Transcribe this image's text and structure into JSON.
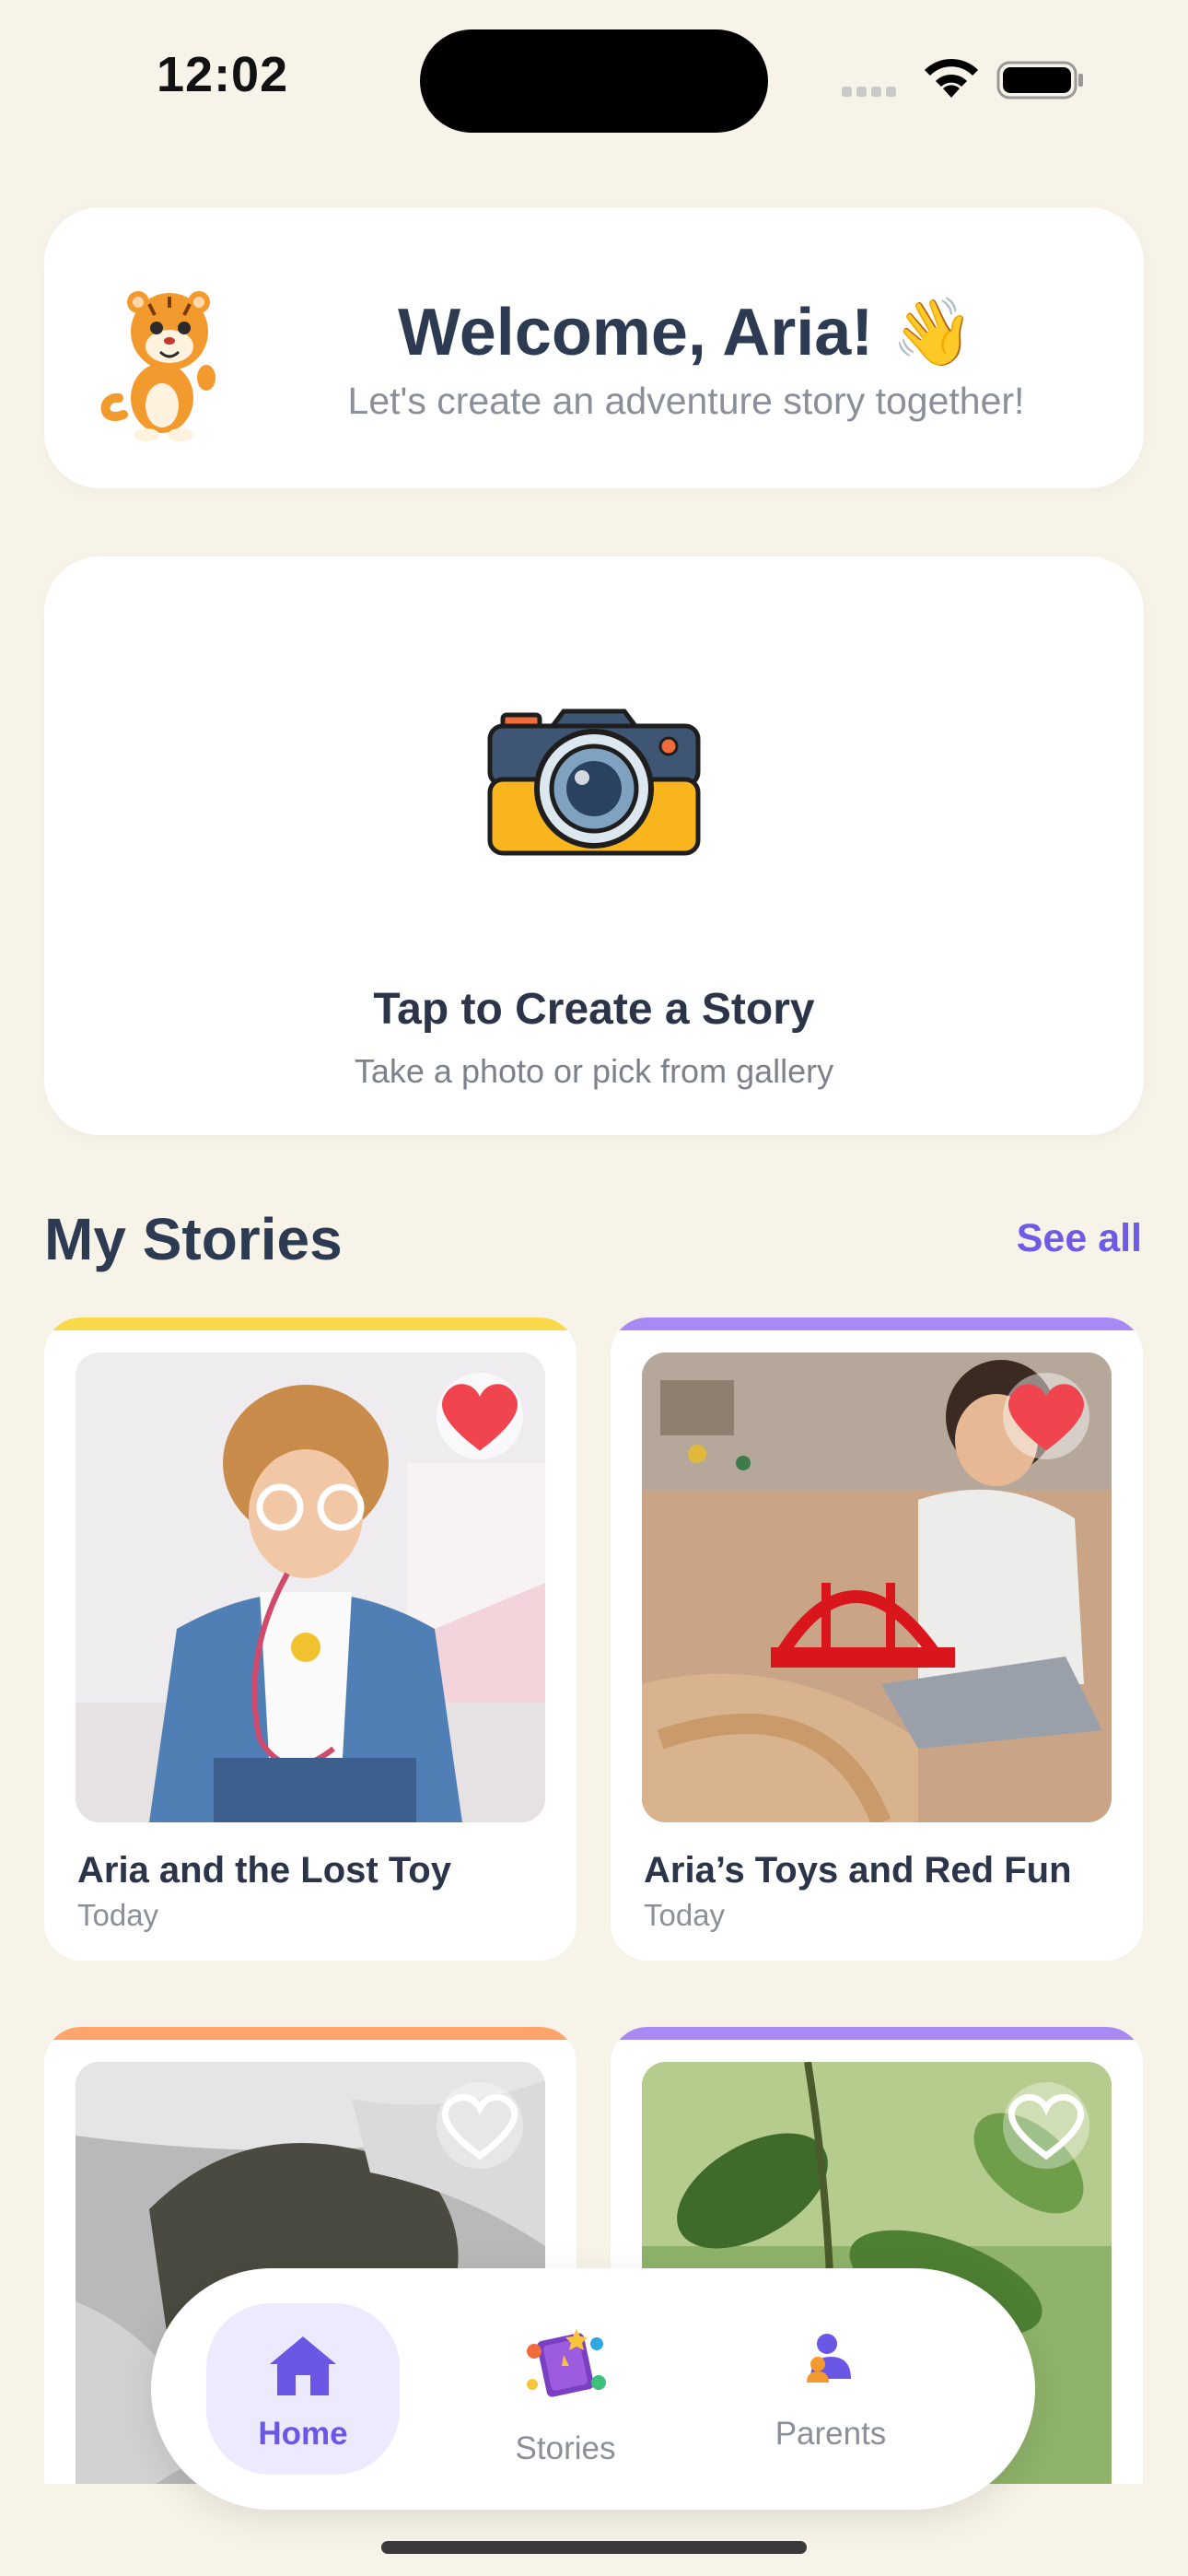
{
  "status_bar": {
    "time": "12:02",
    "icons": [
      "signal-dots-icon",
      "wifi-icon",
      "battery-icon"
    ]
  },
  "welcome": {
    "title": "Welcome, Aria! 👋",
    "subtitle": "Let's create an adventure story together!",
    "mascot_icon": "tiger-mascot-icon"
  },
  "create": {
    "title": "Tap to Create a Story",
    "subtitle": "Take a photo or pick from gallery",
    "icon": "camera-icon"
  },
  "stories_section": {
    "title": "My Stories",
    "see_all": "See all",
    "items": [
      {
        "title": "Aria and the Lost Toy",
        "date": "Today",
        "favorite": true,
        "accent": "#F9D84A",
        "image": "child-doctor-photo"
      },
      {
        "title": "Aria’s Toys and Red Fun",
        "date": "Today",
        "favorite": true,
        "accent": "#A98AF5",
        "image": "child-train-bridge-photo"
      },
      {
        "title": "",
        "date": "",
        "favorite": false,
        "accent": "#FFA56B",
        "image": "waterfall-rock-photo"
      },
      {
        "title": "",
        "date": "",
        "favorite": false,
        "accent": "#A98AF5",
        "image": "green-leaves-photo"
      }
    ]
  },
  "nav": {
    "items": [
      {
        "label": "Home",
        "icon": "home-icon",
        "active": true
      },
      {
        "label": "Stories",
        "icon": "storybook-icon",
        "active": false
      },
      {
        "label": "Parents",
        "icon": "parent-icon",
        "active": false
      }
    ]
  },
  "colors": {
    "background": "#F8F3E8",
    "accent_purple": "#6F5CE6",
    "heart_red": "#F0444F",
    "text_dark": "#2D3B52",
    "text_muted": "#8A8F99"
  }
}
